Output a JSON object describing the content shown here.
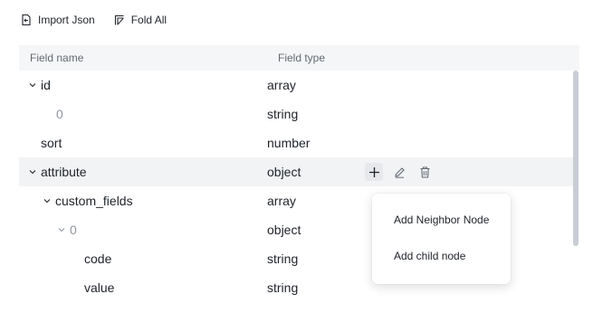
{
  "toolbar": {
    "import_label": "Import Json",
    "import_icon": "import-file-icon",
    "fold_label": "Fold All",
    "fold_icon": "fold-icon"
  },
  "table": {
    "headers": {
      "name": "Field name",
      "type": "Field type"
    },
    "rows": [
      {
        "name": "id",
        "type": "array",
        "expandable": true,
        "muted": false
      },
      {
        "name": "0",
        "type": "string",
        "expandable": false,
        "muted": true
      },
      {
        "name": "sort",
        "type": "number",
        "expandable": false,
        "muted": false
      },
      {
        "name": "attribute",
        "type": "object",
        "expandable": true,
        "muted": false,
        "hovered": true
      },
      {
        "name": "custom_fields",
        "type": "array",
        "expandable": true,
        "muted": false
      },
      {
        "name": "0",
        "type": "object",
        "expandable": true,
        "muted": true
      },
      {
        "name": "code",
        "type": "string",
        "expandable": false,
        "muted": false
      },
      {
        "name": "value",
        "type": "string",
        "expandable": false,
        "muted": false
      }
    ]
  },
  "row_actions": {
    "add_icon": "plus-icon",
    "edit_icon": "pencil-icon",
    "delete_icon": "trash-icon"
  },
  "context_menu": {
    "items": [
      {
        "label": "Add Neighbor Node"
      },
      {
        "label": "Add child node"
      }
    ]
  },
  "colors": {
    "header_bg": "#f5f6f7",
    "hover_bg": "#f2f3f5",
    "text": "#1f2329",
    "muted_text": "#8f959e"
  }
}
